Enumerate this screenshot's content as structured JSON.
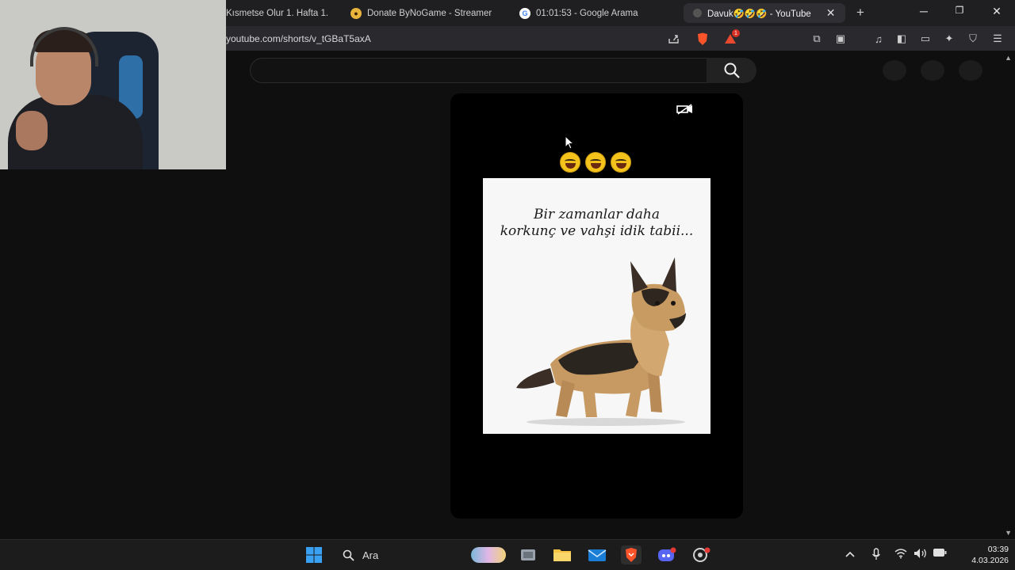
{
  "browser": {
    "tabs": [
      {
        "label": "Kısmetse Olur 1. Hafta 1.",
        "active": false
      },
      {
        "label": "Donate ByNoGame - Streamer",
        "active": false
      },
      {
        "label": "01:01:53 - Google Arama",
        "active": false
      },
      {
        "label": "Davuk🤣🤣🤣 - YouTube",
        "active": true
      }
    ],
    "url": "youtube.com/shorts/v_tGBaT5axA",
    "brave_badge_count": "1"
  },
  "youtube": {
    "search_placeholder": ""
  },
  "short": {
    "emojis": "🤣🤣🤣",
    "meme_caption_line1": "Bir zamanlar daha",
    "meme_caption_line2": "korkunç ve vahşi idik tabii..."
  },
  "taskbar": {
    "search_label": "Ara",
    "time": "03:39",
    "date": "4.03.2026"
  },
  "colors": {
    "youtube_bg": "#0f0f0f",
    "brave_orange": "#fb542b",
    "windows_blue": "#3aa0f2"
  }
}
